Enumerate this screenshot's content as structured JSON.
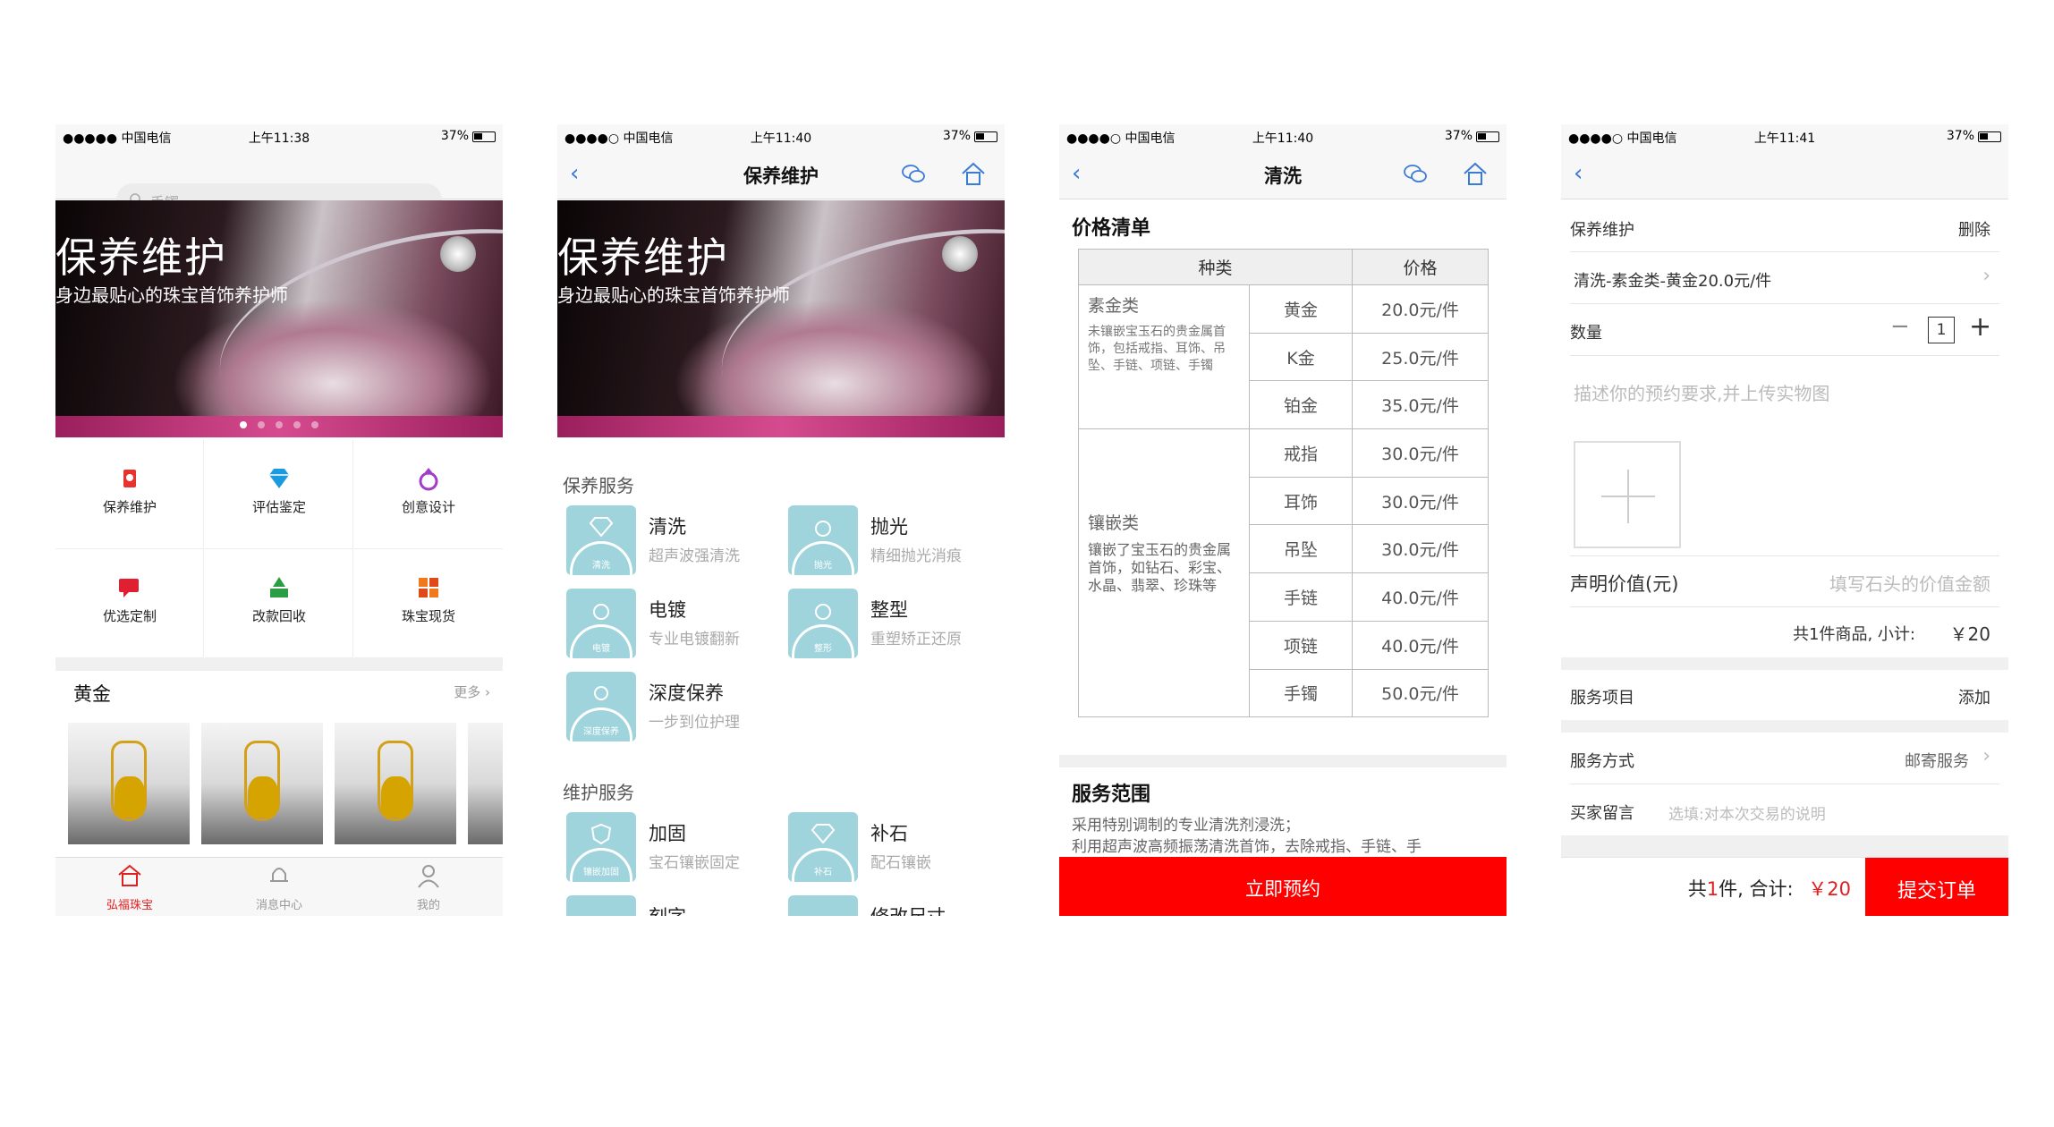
{
  "status": {
    "carrier": "●●●●● 中国电信",
    "carrier2": "●●●●○ 中国电信",
    "battery": "37%",
    "time1": "上午11:38",
    "time2": "上午11:40",
    "time3": "上午11:40",
    "time4": "上午11:41"
  },
  "screen1": {
    "search_placeholder": "手镯",
    "banner_title": "保养维护",
    "banner_subtitle": "身边最贴心的珠宝首饰养护师",
    "grid": [
      {
        "label": "保养维护",
        "icon": "phone-heart-icon",
        "color": "#e8322e"
      },
      {
        "label": "评估鉴定",
        "icon": "diamond-icon",
        "color": "#1a9be0"
      },
      {
        "label": "创意设计",
        "icon": "ring-icon",
        "color": "#a33cc9"
      },
      {
        "label": "优选定制",
        "icon": "chat-icon",
        "color": "#e02030"
      },
      {
        "label": "改款回收",
        "icon": "recycle-icon",
        "color": "#2a9d45"
      },
      {
        "label": "珠宝现货",
        "icon": "blocks-icon",
        "color": "#f07a1a"
      }
    ],
    "section_title": "黄金",
    "more": "更多 ›",
    "tabs": [
      {
        "label": "弘福珠宝",
        "icon": "home-icon"
      },
      {
        "label": "消息中心",
        "icon": "bell-icon"
      },
      {
        "label": "我的",
        "icon": "user-icon"
      }
    ]
  },
  "screen2": {
    "title": "保养维护",
    "banner_title": "保养维护",
    "banner_subtitle": "身边最贴心的珠宝首饰养护师",
    "group1_title": "保养服务",
    "group1": [
      {
        "name": "清洗",
        "desc": "超声波强清洗",
        "badge": "清洗"
      },
      {
        "name": "抛光",
        "desc": "精细抛光消痕",
        "badge": "抛光"
      },
      {
        "name": "电镀",
        "desc": "专业电镀翻新",
        "badge": "电镀"
      },
      {
        "name": "整型",
        "desc": "重塑矫正还原",
        "badge": "整形"
      },
      {
        "name": "深度保养",
        "desc": "一步到位护理",
        "badge": "深度保养"
      }
    ],
    "group2_title": "维护服务",
    "group2": [
      {
        "name": "加固",
        "desc": "宝石镶嵌固定",
        "badge": "镶嵌加固"
      },
      {
        "name": "补石",
        "desc": "配石镶嵌",
        "badge": "补石"
      },
      {
        "name": "刻字",
        "desc": "",
        "badge": ""
      },
      {
        "name": "修改尺寸",
        "desc": "",
        "badge": ""
      }
    ]
  },
  "screen3": {
    "title": "清洗",
    "price_list_title": "价格清单",
    "col_type": "种类",
    "col_price": "价格",
    "cat1": {
      "name": "素金类",
      "desc": "未镶嵌宝玉石的贵金属首饰，包括戒指、耳饰、吊坠、手链、项链、手镯"
    },
    "cat2": {
      "name": "镶嵌类",
      "desc": "镶嵌了宝玉石的贵金属首饰，如钻石、彩宝、水晶、翡翠、珍珠等"
    },
    "rows": [
      {
        "item": "黄金",
        "price": "20.0元/件"
      },
      {
        "item": "K金",
        "price": "25.0元/件"
      },
      {
        "item": "铂金",
        "price": "35.0元/件"
      },
      {
        "item": "戒指",
        "price": "30.0元/件"
      },
      {
        "item": "耳饰",
        "price": "30.0元/件"
      },
      {
        "item": "吊坠",
        "price": "30.0元/件"
      },
      {
        "item": "手链",
        "price": "40.0元/件"
      },
      {
        "item": "项链",
        "price": "40.0元/件"
      },
      {
        "item": "手镯",
        "price": "50.0元/件"
      }
    ],
    "scope_title": "服务范围",
    "scope_text1": "采用特别调制的专业清洗剂浸洗；",
    "scope_text2": "利用超声波高频振荡清洗首饰，去除戒指、手链、手",
    "book_button": "立即预约"
  },
  "screen4": {
    "section": "保养维护",
    "delete": "删除",
    "item": "清洗-素金类-黄金20.0元/件",
    "qty_label": "数量",
    "qty_value": "1",
    "desc_placeholder": "描述你的预约要求,并上传实物图",
    "declared_label": "声明价值(元)",
    "declared_placeholder": "填写石头的价值金额",
    "subtotal_label": "共1件商品, 小计:",
    "subtotal_value": "￥20",
    "service_items": "服务项目",
    "add": "添加",
    "service_method": "服务方式",
    "service_method_value": "邮寄服务",
    "buyer_msg": "买家留言",
    "buyer_msg_placeholder": "选填:对本次交易的说明",
    "total_prefix": "共",
    "total_count": "1",
    "total_suffix": "件, 合计:",
    "total_value": "￥20",
    "submit": "提交订单"
  }
}
